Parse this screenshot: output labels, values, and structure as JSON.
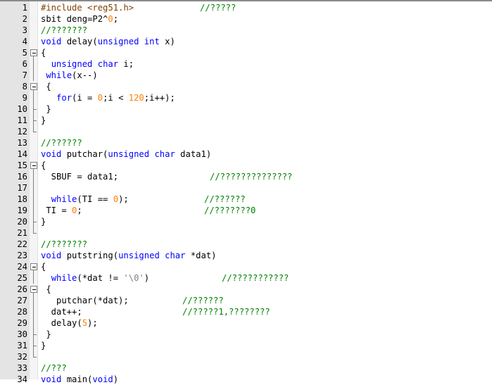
{
  "editor": {
    "lines": [
      {
        "n": "1",
        "code": "#include <reg51.h>",
        "comment": "//?????"
      },
      {
        "n": "2",
        "code": "sbit deng=P2^0;",
        "comment": ""
      },
      {
        "n": "3",
        "code": "//???????",
        "comment": ""
      },
      {
        "n": "4",
        "code": "void delay(unsigned int x)",
        "comment": ""
      },
      {
        "n": "5",
        "code": "{",
        "comment": ""
      },
      {
        "n": "6",
        "code": "  unsigned char i;",
        "comment": ""
      },
      {
        "n": "7",
        "code": " while(x--)",
        "comment": ""
      },
      {
        "n": "8",
        "code": " {",
        "comment": ""
      },
      {
        "n": "9",
        "code": "   for(i = 0;i < 120;i++);",
        "comment": ""
      },
      {
        "n": "10",
        "code": " }",
        "comment": ""
      },
      {
        "n": "11",
        "code": "}",
        "comment": ""
      },
      {
        "n": "12",
        "code": "",
        "comment": ""
      },
      {
        "n": "13",
        "code": "//??????",
        "comment": ""
      },
      {
        "n": "14",
        "code": "void putchar(unsigned char data1)",
        "comment": ""
      },
      {
        "n": "15",
        "code": "{",
        "comment": ""
      },
      {
        "n": "16",
        "code": "  SBUF = data1;",
        "comment": "//??????????????"
      },
      {
        "n": "17",
        "code": "",
        "comment": ""
      },
      {
        "n": "18",
        "code": "  while(TI == 0);",
        "comment": "//??????"
      },
      {
        "n": "19",
        "code": " TI = 0;",
        "comment": "//???????0"
      },
      {
        "n": "20",
        "code": "}",
        "comment": ""
      },
      {
        "n": "21",
        "code": "",
        "comment": ""
      },
      {
        "n": "22",
        "code": "//???????",
        "comment": ""
      },
      {
        "n": "23",
        "code": "void putstring(unsigned char *dat)",
        "comment": ""
      },
      {
        "n": "24",
        "code": "{",
        "comment": ""
      },
      {
        "n": "25",
        "code": "  while(*dat != '\\0')",
        "comment": "//???????????"
      },
      {
        "n": "26",
        "code": " {",
        "comment": ""
      },
      {
        "n": "27",
        "code": "   putchar(*dat);",
        "comment": "//??????"
      },
      {
        "n": "28",
        "code": "  dat++;",
        "comment": "//?????1,????????"
      },
      {
        "n": "29",
        "code": "  delay(5);",
        "comment": ""
      },
      {
        "n": "30",
        "code": " }",
        "comment": ""
      },
      {
        "n": "31",
        "code": "}",
        "comment": ""
      },
      {
        "n": "32",
        "code": "",
        "comment": ""
      },
      {
        "n": "33",
        "code": "//???",
        "comment": ""
      },
      {
        "n": "34",
        "code": "void main(void)",
        "comment": ""
      }
    ],
    "colors": {
      "keyword": "#0000ff",
      "preprocessor": "#804000",
      "comment": "#008000",
      "string": "#808080",
      "number": "#ff8000",
      "gutter_bg": "#e4e4e4"
    }
  }
}
